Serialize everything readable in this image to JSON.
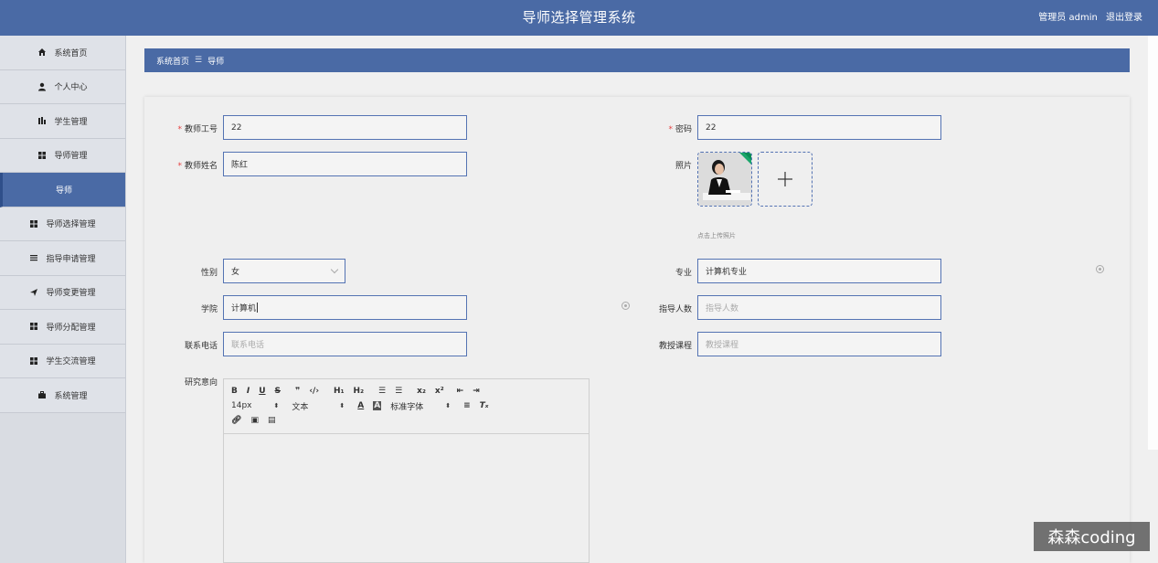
{
  "header": {
    "title": "导师选择管理系统",
    "user_label": "管理员 admin",
    "logout_label": "退出登录"
  },
  "sidebar": {
    "items": [
      {
        "label": "系统首页",
        "icon": "home-icon"
      },
      {
        "label": "个人中心",
        "icon": "user-icon"
      },
      {
        "label": "学生管理",
        "icon": "bar-chart-icon"
      },
      {
        "label": "导师管理",
        "icon": "grid-icon"
      },
      {
        "label": "导师",
        "icon": ""
      },
      {
        "label": "导师选择管理",
        "icon": "grid-icon"
      },
      {
        "label": "指导申请管理",
        "icon": "list-icon"
      },
      {
        "label": "导师变更管理",
        "icon": "send-icon"
      },
      {
        "label": "导师分配管理",
        "icon": "grid-icon"
      },
      {
        "label": "学生交流管理",
        "icon": "grid-icon"
      },
      {
        "label": "系统管理",
        "icon": "briefcase-icon"
      }
    ]
  },
  "breadcrumb": {
    "home": "系统首页",
    "separator": "☰",
    "current": "导师"
  },
  "form": {
    "teacher_no": {
      "label": "教师工号",
      "value": "22"
    },
    "password": {
      "label": "密码",
      "value": "22"
    },
    "teacher_name": {
      "label": "教师姓名",
      "value": "陈红"
    },
    "photo": {
      "label": "照片",
      "hint": "点击上传照片"
    },
    "gender": {
      "label": "性别",
      "value": "女"
    },
    "major": {
      "label": "专业",
      "value": "计算机专业"
    },
    "college": {
      "label": "学院",
      "value": "计算机"
    },
    "guide_count": {
      "label": "指导人数",
      "placeholder": "指导人数"
    },
    "phone": {
      "label": "联系电话",
      "placeholder": "联系电话"
    },
    "courses": {
      "label": "教授课程",
      "placeholder": "教授课程"
    },
    "research": {
      "label": "研究意向"
    }
  },
  "editor": {
    "font_size": "14px",
    "text_type": "文本",
    "font_family": "标准字体"
  },
  "watermark": "森森coding"
}
